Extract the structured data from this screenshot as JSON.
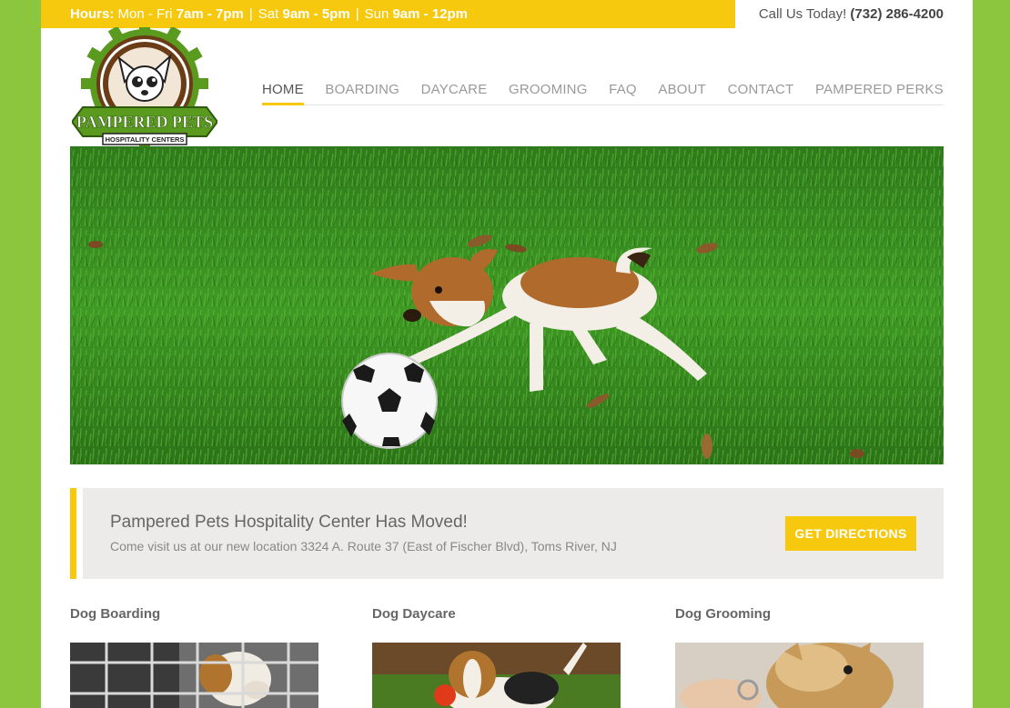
{
  "topbar": {
    "hours_label": "Hours:",
    "weekday_label": "Mon - Fri",
    "weekday_time": "7am - 7pm",
    "sat_label": "Sat",
    "sat_time": "9am - 5pm",
    "sun_label": "Sun",
    "sun_time": "9am - 12pm",
    "separator": "|",
    "call_label": "Call Us Today!",
    "phone": "(732) 286-4200"
  },
  "logo": {
    "line1": "PAMPERED PETS",
    "line2": "HOSPITALITY CENTERS"
  },
  "nav": {
    "items": [
      {
        "label": "HOME",
        "active": true
      },
      {
        "label": "BOARDING"
      },
      {
        "label": "DAYCARE"
      },
      {
        "label": "GROOMING"
      },
      {
        "label": "FAQ"
      },
      {
        "label": "ABOUT"
      },
      {
        "label": "CONTACT"
      },
      {
        "label": "PAMPERED PERKS"
      }
    ]
  },
  "announcement": {
    "title": "Pampered Pets Hospitality Center Has Moved!",
    "subtitle": "Come visit us at our new location 3324 A. Route 37 (East of Fischer Blvd), Toms River, NJ",
    "button_label": "GET DIRECTIONS"
  },
  "services": [
    {
      "title": "Dog Boarding"
    },
    {
      "title": "Dog Daycare"
    },
    {
      "title": "Dog Grooming"
    }
  ],
  "colors": {
    "accent_yellow": "#f6c90e",
    "page_green": "#8cc63f",
    "logo_green": "#5a9a1e",
    "logo_brown": "#6b3d17"
  },
  "icons": [
    "logo-chihuahua-icon",
    "soccer-ball-icon"
  ]
}
